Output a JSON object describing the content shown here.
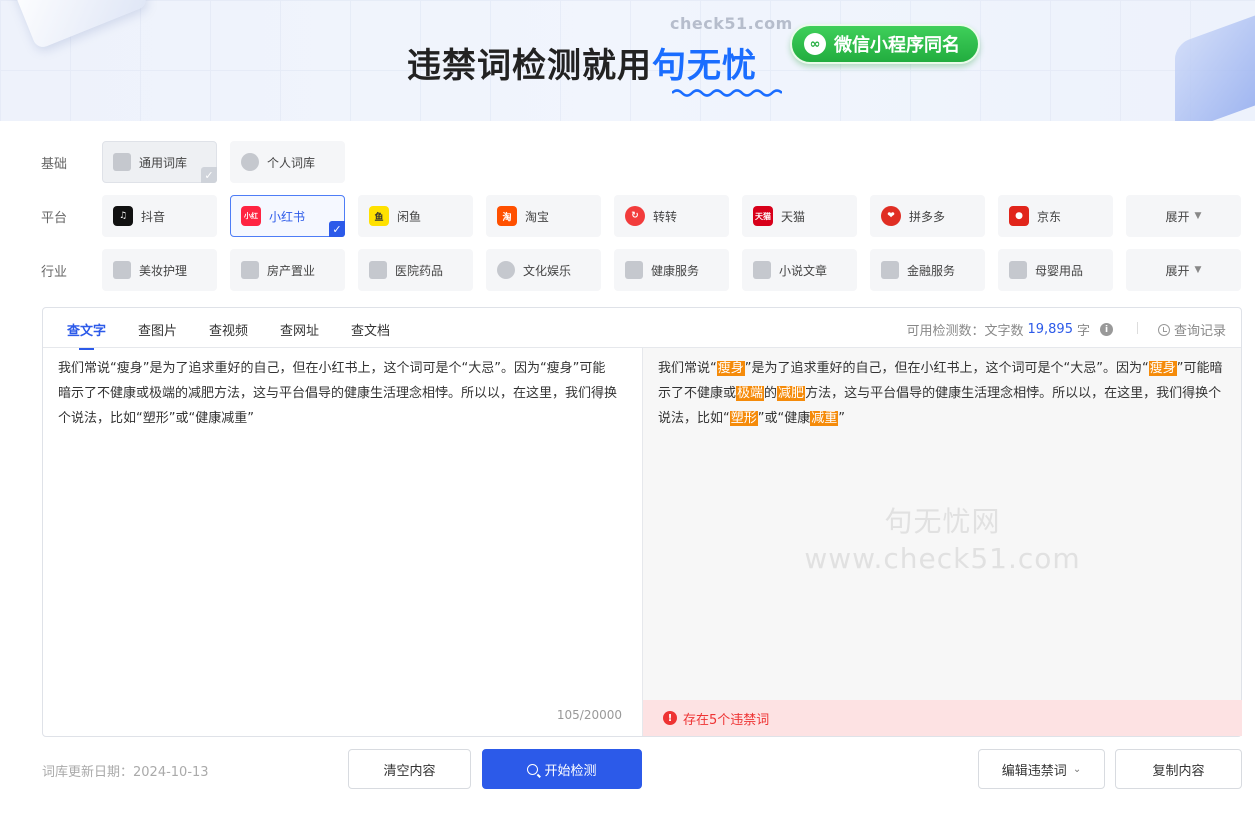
{
  "banner": {
    "site": "check51.com",
    "headline_prefix": "违禁词检测就用",
    "headline_brand": "句无忧",
    "mini_program": "微信小程序同名",
    "mini_program_icon": "link-icon"
  },
  "rows": {
    "basic": {
      "label": "基础",
      "items": [
        {
          "label": "通用词库",
          "icon": "cube-icon",
          "selected": true
        },
        {
          "label": "个人词库",
          "icon": "user-icon",
          "selected": false
        }
      ]
    },
    "platform": {
      "label": "平台",
      "items": [
        {
          "label": "抖音",
          "icon": "douyin-icon",
          "color": "#111111",
          "selected": false
        },
        {
          "label": "小红书",
          "icon": "xiaohongshu-icon",
          "color": "#ff2442",
          "selected": true
        },
        {
          "label": "闲鱼",
          "icon": "xianyu-icon",
          "color": "#ffe100",
          "selected": false
        },
        {
          "label": "淘宝",
          "icon": "taobao-icon",
          "color": "#ff5000",
          "selected": false
        },
        {
          "label": "转转",
          "icon": "zhuanzhuan-icon",
          "color": "#f23c3c",
          "selected": false
        },
        {
          "label": "天猫",
          "icon": "tmall-icon",
          "color": "#d8001a",
          "selected": false
        },
        {
          "label": "拼多多",
          "icon": "pinduoduo-icon",
          "color": "#e02e24",
          "selected": false
        },
        {
          "label": "京东",
          "icon": "jd-icon",
          "color": "#e1251b",
          "selected": false
        }
      ],
      "expand": "展开"
    },
    "industry": {
      "label": "行业",
      "items": [
        {
          "label": "美妆护理",
          "icon": "cosmetics-icon"
        },
        {
          "label": "房产置业",
          "icon": "building-icon"
        },
        {
          "label": "医院药品",
          "icon": "hospital-icon"
        },
        {
          "label": "文化娱乐",
          "icon": "film-icon"
        },
        {
          "label": "健康服务",
          "icon": "medical-kit-icon"
        },
        {
          "label": "小说文章",
          "icon": "book-icon"
        },
        {
          "label": "金融服务",
          "icon": "card-icon"
        },
        {
          "label": "母婴用品",
          "icon": "baby-bottle-icon"
        }
      ],
      "expand": "展开"
    }
  },
  "tabs": [
    {
      "label": "查文字",
      "active": true
    },
    {
      "label": "查图片",
      "active": false
    },
    {
      "label": "查视频",
      "active": false
    },
    {
      "label": "查网址",
      "active": false
    },
    {
      "label": "查文档",
      "active": false
    }
  ],
  "quota": {
    "prefix": "可用检测数：文字数",
    "value": "19,895",
    "unit": "字"
  },
  "history": "查询记录",
  "input_text": "我们常说“瘦身”是为了追求重好的自己，但在小红书上，这个词可是个“大忌”。因为“瘦身”可能暗示了不健康或极端的减肥方法，这与平台倡导的健康生活理念相悖。所以以，在这里，我们得换个说法，比如“塑形”或“健康减重”",
  "char_count": "105/20000",
  "result_segments": [
    {
      "t": "我们常说“",
      "m": false
    },
    {
      "t": "瘦身",
      "m": true
    },
    {
      "t": "”是为了追求重好的自己，但在小红书上，这个词可是个“大忌”。因为“",
      "m": false
    },
    {
      "t": "瘦身",
      "m": true
    },
    {
      "t": "”可能暗示了不健康或",
      "m": false
    },
    {
      "t": "极端",
      "m": true
    },
    {
      "t": "的",
      "m": false
    },
    {
      "t": "减肥",
      "m": true
    },
    {
      "t": "方法，这与平台倡导的健康生活理念相悖。所以以，在这里，我们得换个说法，比如“",
      "m": false
    },
    {
      "t": "塑形",
      "m": true
    },
    {
      "t": "”或“健康",
      "m": false
    },
    {
      "t": "减重",
      "m": true
    },
    {
      "t": "”",
      "m": false
    }
  ],
  "watermark": {
    "line1": "句无忧网",
    "line2": "www.check51.com"
  },
  "warning": "存在5个违禁词",
  "footer": {
    "update_date": "词库更新日期：2024-10-13",
    "clear": "清空内容",
    "start": "开始检测",
    "edit": "编辑违禁词",
    "copy": "复制内容"
  },
  "colors": {
    "accent": "#2c5ae9",
    "highlight": "#f58b0a",
    "warning": "#e33333",
    "mini_program": "#22ad3f"
  }
}
